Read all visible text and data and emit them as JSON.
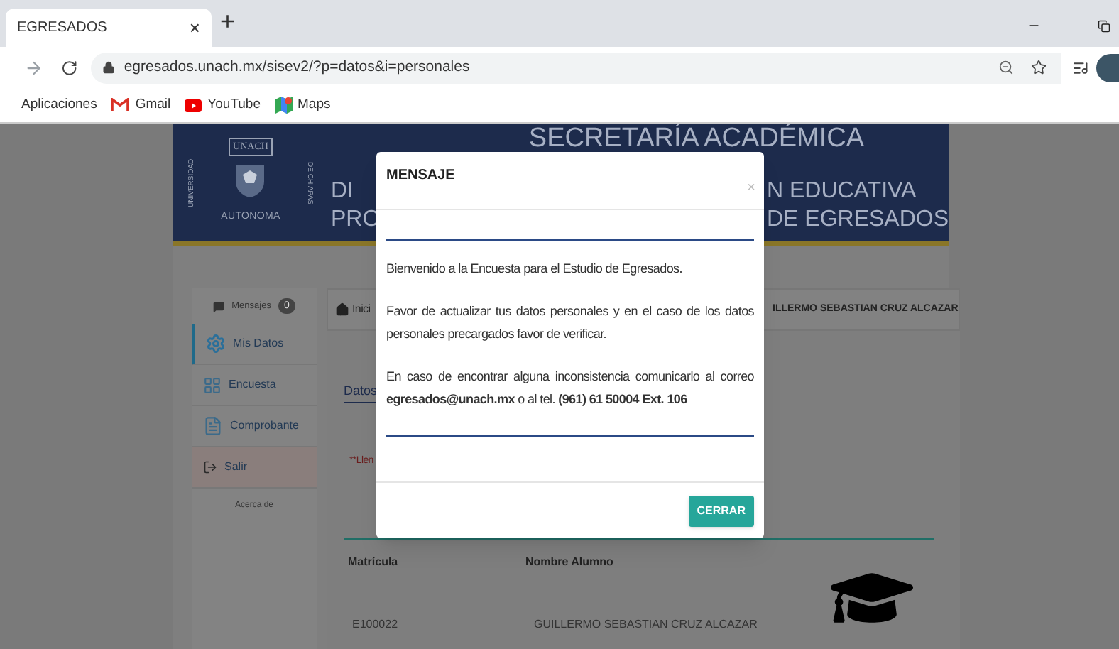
{
  "browser": {
    "tab": {
      "title": "EGRESADOS",
      "close": "×",
      "selected": true
    },
    "new_tab": "+",
    "url": "egresados.unach.mx/sisev2/?p=datos&i=personales",
    "bookmarks": [
      {
        "label": "Aplicaciones",
        "kind": "apps"
      },
      {
        "label": "Gmail",
        "kind": "gmail"
      },
      {
        "label": "YouTube",
        "kind": "youtube"
      },
      {
        "label": "Maps",
        "kind": "maps"
      }
    ]
  },
  "header": {
    "logo": {
      "top": "UNACH",
      "left": "UNIVERSIDAD",
      "right": "DE CHIAPAS",
      "bottom": "AUTONOMA"
    },
    "title": "SECRETARÍA ACADÉMICA",
    "line_2_left": "DI",
    "line_2_right": "N EDUCATIVA",
    "line_3_left": "PRO",
    "line_3_right": "DE EGRESADOS"
  },
  "sidebar": {
    "messages": {
      "label": "Mensajes",
      "count": "0"
    },
    "items": [
      {
        "label": "Mis Datos",
        "kind": "gear",
        "selected": true
      },
      {
        "label": "Encuesta",
        "kind": "survey",
        "selected": false
      },
      {
        "label": "Comprobante",
        "kind": "receipt",
        "selected": false
      },
      {
        "label": "Salir",
        "kind": "exit",
        "selected": false
      }
    ],
    "about": "Acerca de"
  },
  "breadcrumb": {
    "home": "Inici",
    "user": "ILLERMO SEBASTIAN CRUZ ALCAZAR"
  },
  "content": {
    "tab": "Datos",
    "note": "**Llen",
    "table": {
      "columns": [
        "Matrícula",
        "Nombre Alumno"
      ],
      "rows": [
        [
          "E100022",
          "GUILLERMO SEBASTIAN CRUZ ALCAZAR"
        ]
      ]
    }
  },
  "modal": {
    "title": "MENSAJE",
    "close": "×",
    "paragraphs": [
      "Bienvenido a la Encuesta para el Estudio de Egresados.",
      "Favor de actualizar tus datos personales y en el caso de los datos personales precargados favor de verificar.",
      "En caso de encontrar alguna inconsistencia comunicarlo al correo **egresados@unach.mx** o al tel. **(961) 61 50004 Ext. 106**"
    ],
    "button": "CERRAR"
  }
}
